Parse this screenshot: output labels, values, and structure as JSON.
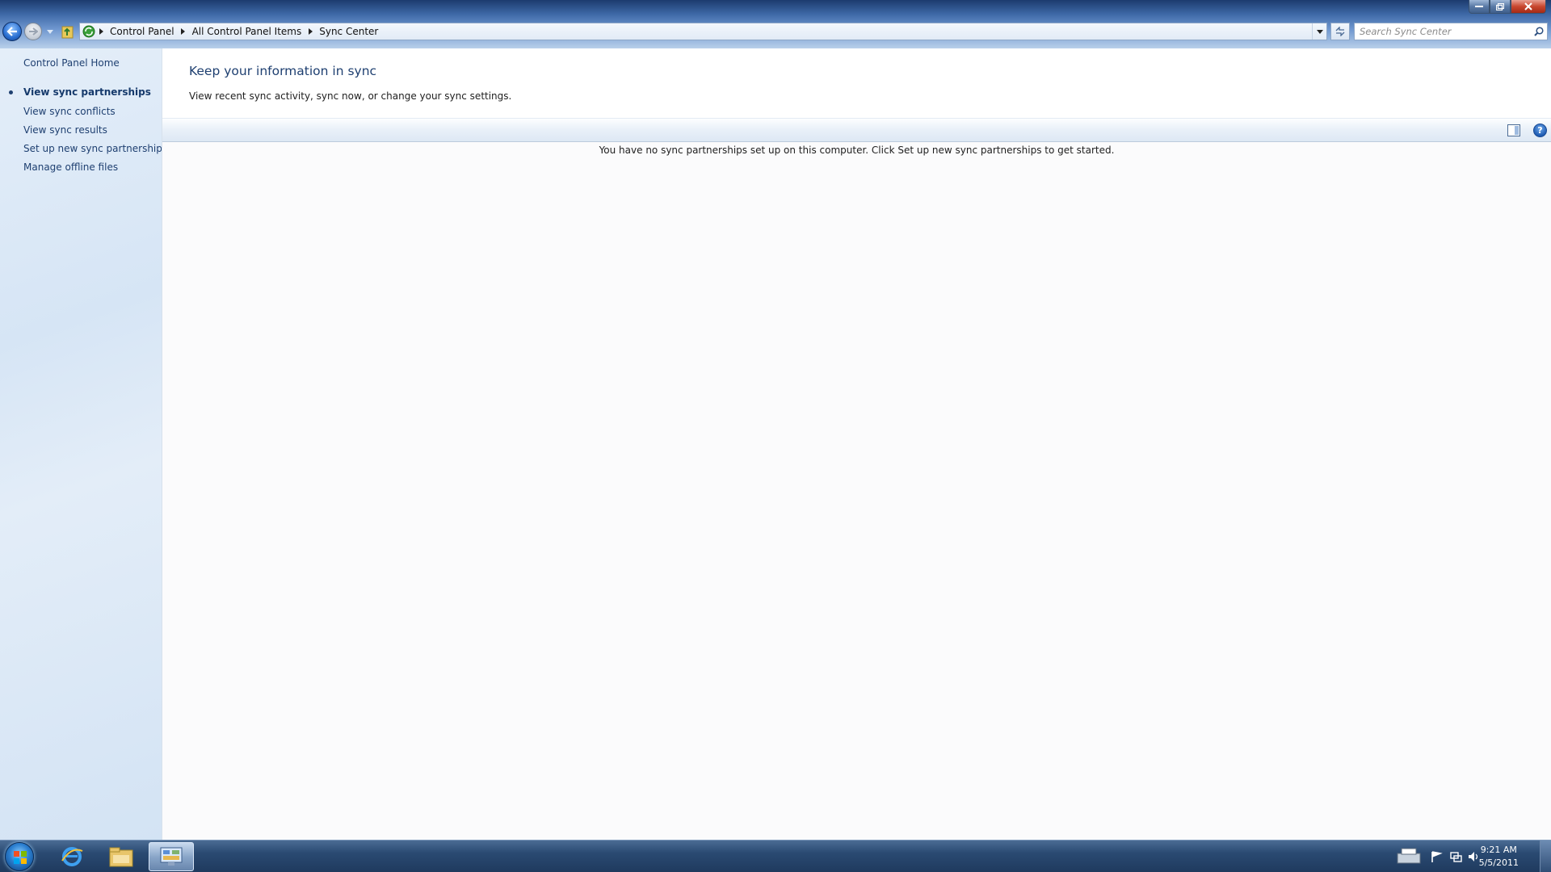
{
  "window": {
    "address": {
      "crumbs": [
        "Control Panel",
        "All Control Panel Items",
        "Sync Center"
      ]
    },
    "search": {
      "placeholder": "Search Sync Center"
    }
  },
  "left_pane": {
    "home_link": "Control Panel Home",
    "links": [
      {
        "label": "View sync partnerships",
        "selected": true
      },
      {
        "label": "View sync conflicts",
        "selected": false
      },
      {
        "label": "View sync results",
        "selected": false
      },
      {
        "label": "Set up new sync partnerships",
        "selected": false
      },
      {
        "label": "Manage offline files",
        "selected": false
      }
    ]
  },
  "main": {
    "title": "Keep your information in sync",
    "description": "View recent sync activity, sync now, or change your sync settings.",
    "empty_message": "You have no sync partnerships set up on this computer. Click Set up new sync partnerships to get started.",
    "help_glyph": "?"
  },
  "taskbar": {
    "apps": [
      "internet-explorer",
      "windows-explorer",
      "control-panel"
    ],
    "clock": {
      "time": "9:21 AM",
      "date": "5/5/2011"
    }
  },
  "colors": {
    "link": "#1e3f70",
    "title": "#1e3f70",
    "taskbar": "#2a4a72"
  }
}
